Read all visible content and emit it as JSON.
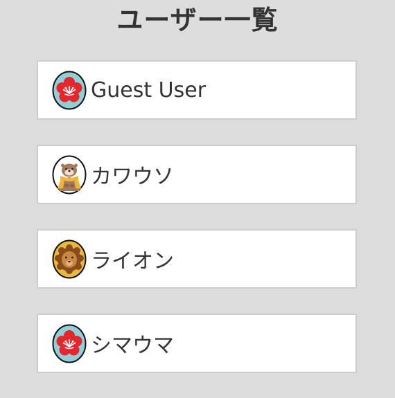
{
  "header": {
    "title": "ユーザー一覧"
  },
  "users": [
    {
      "name": "Guest User",
      "avatar": "plum-flower-icon"
    },
    {
      "name": "カワウソ",
      "avatar": "otter-icon"
    },
    {
      "name": "ライオン",
      "avatar": "lion-icon"
    },
    {
      "name": "シマウマ",
      "avatar": "plum-flower-icon"
    }
  ],
  "colors": {
    "background": "#dddddd",
    "card": "#ffffff",
    "card_border": "#cccccc",
    "text": "#333333",
    "plum_bg": "#8fd0d8",
    "plum_flower": "#e8252a",
    "lion_bg": "#e8b93a"
  }
}
